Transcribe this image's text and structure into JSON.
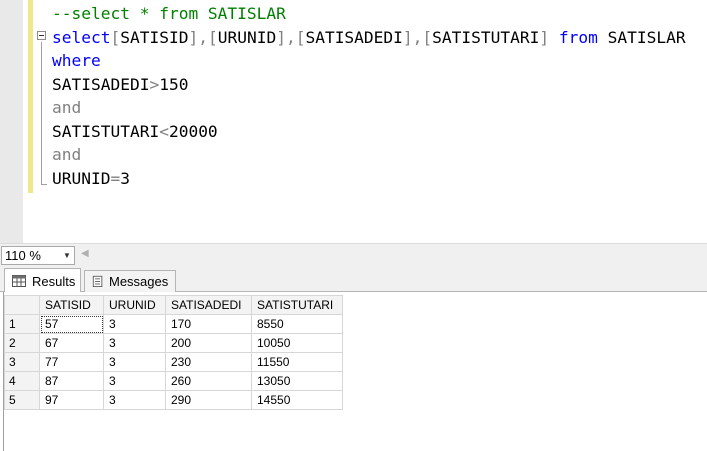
{
  "editor": {
    "lines": [
      {
        "tokens": [
          {
            "cls": "cm",
            "text": "--select * from SATISLAR"
          }
        ]
      },
      {
        "tokens": [
          {
            "cls": "kw",
            "text": "select"
          },
          {
            "cls": "op",
            "text": "["
          },
          {
            "cls": "tx",
            "text": "SATISID"
          },
          {
            "cls": "op",
            "text": "],"
          },
          {
            "cls": "op",
            "text": "["
          },
          {
            "cls": "tx",
            "text": "URUNID"
          },
          {
            "cls": "op",
            "text": "],"
          },
          {
            "cls": "op",
            "text": "["
          },
          {
            "cls": "tx",
            "text": "SATISADEDI"
          },
          {
            "cls": "op",
            "text": "],"
          },
          {
            "cls": "op",
            "text": "["
          },
          {
            "cls": "tx",
            "text": "SATISTUTARI"
          },
          {
            "cls": "op",
            "text": "]"
          },
          {
            "cls": "tx",
            "text": " "
          },
          {
            "cls": "kw",
            "text": "from"
          },
          {
            "cls": "tx",
            "text": " SATISLAR"
          }
        ]
      },
      {
        "tokens": [
          {
            "cls": "kw",
            "text": "where"
          }
        ]
      },
      {
        "tokens": [
          {
            "cls": "tx",
            "text": "SATISADEDI"
          },
          {
            "cls": "op",
            "text": ">"
          },
          {
            "cls": "tx",
            "text": "150"
          }
        ]
      },
      {
        "tokens": [
          {
            "cls": "gr",
            "text": "and"
          }
        ]
      },
      {
        "tokens": [
          {
            "cls": "tx",
            "text": "SATISTUTARI"
          },
          {
            "cls": "op",
            "text": "<"
          },
          {
            "cls": "tx",
            "text": "20000"
          }
        ]
      },
      {
        "tokens": [
          {
            "cls": "gr",
            "text": "and"
          }
        ]
      },
      {
        "tokens": [
          {
            "cls": "tx",
            "text": "URUNID"
          },
          {
            "cls": "op",
            "text": "="
          },
          {
            "cls": "tx",
            "text": "3"
          }
        ]
      }
    ]
  },
  "zoom": {
    "value": "110 %"
  },
  "tabs": {
    "results_label": "Results",
    "messages_label": "Messages"
  },
  "grid": {
    "columns": [
      "SATISID",
      "URUNID",
      "SATISADEDI",
      "SATISTUTARI"
    ],
    "rows": [
      {
        "num": "1",
        "cells": [
          "57",
          "3",
          "170",
          "8550"
        ]
      },
      {
        "num": "2",
        "cells": [
          "67",
          "3",
          "200",
          "10050"
        ]
      },
      {
        "num": "3",
        "cells": [
          "77",
          "3",
          "230",
          "11550"
        ]
      },
      {
        "num": "4",
        "cells": [
          "87",
          "3",
          "260",
          "13050"
        ]
      },
      {
        "num": "5",
        "cells": [
          "97",
          "3",
          "290",
          "14550"
        ]
      }
    ]
  },
  "colors": {
    "keyword": "#0000ff",
    "comment": "#008000",
    "operator": "#808080",
    "change_bar": "#f0e68c"
  },
  "icons": {
    "results": "grid-icon",
    "messages": "messages-icon",
    "zoom_caret": "chevron-down-icon",
    "scroll_left": "scroll-left-arrow-icon"
  }
}
